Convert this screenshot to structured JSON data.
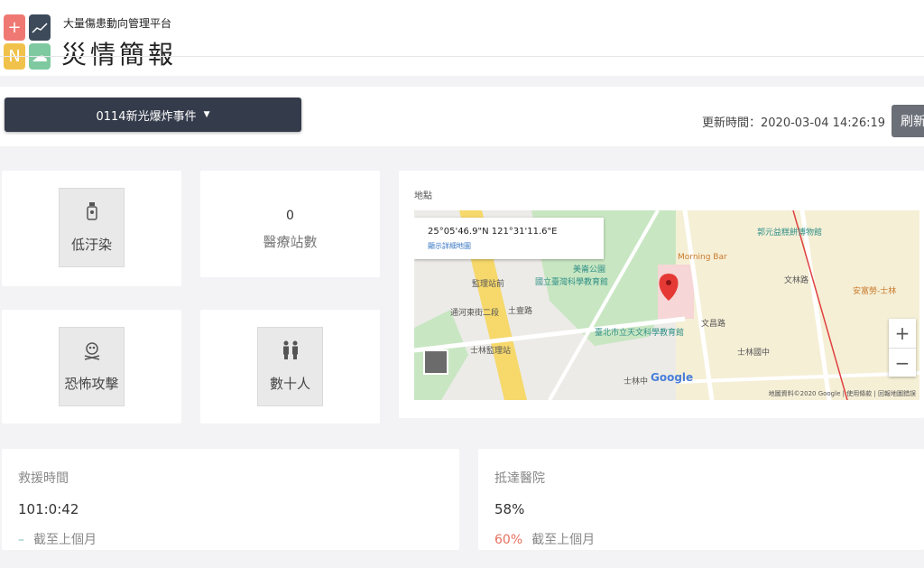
{
  "header": {
    "subtitle": "大量傷患動向管理平台",
    "title": "災情簡報",
    "logo_icons": [
      "plus-icon",
      "trend-icon",
      "n-letter-icon",
      "cloud-icon"
    ]
  },
  "toolbar": {
    "event_label": "0114新光爆炸事件",
    "update_time": "更新時間：2020-03-04 14:26:19",
    "refresh_label": "刷新"
  },
  "tiles": {
    "pollution": "低汙染",
    "terror": "恐怖攻擊",
    "people": "數十人"
  },
  "stats": {
    "medical_stations": {
      "value": "0",
      "label": "醫療站數"
    }
  },
  "map": {
    "title": "地點",
    "coords": "25°05'46.9\"N 121°31'11.6\"E",
    "detail_link": "顯示詳細地圖",
    "labels": {
      "a": "國立臺灣科學教育館",
      "b": "美崙公園",
      "c": "臺北市立天文科學教育館",
      "d": "士林監理站",
      "e": "監理站前",
      "f": "士林國中",
      "g": "Morning Bar",
      "h": "郭元益糕餅博物館",
      "i": "士林中",
      "j": "文昌路",
      "k": "文林路",
      "l": "土壹路",
      "m": "通河東街二段",
      "n": "安富勞-士林"
    },
    "google": "Google",
    "attribution": "地圖資料©2020 Google | 使用條款 | 回報地圖錯誤"
  },
  "rescue": {
    "title": "救援時間",
    "value": "101:0:42",
    "note_dash": "–",
    "note": "截至上個月"
  },
  "hospital": {
    "title": "抵達醫院",
    "value": "58%",
    "note_pct": "60%",
    "note": "截至上個月"
  },
  "colors": {
    "dark_button": "#343b4a",
    "accent_red": "#e5715f",
    "accent_teal": "#7cc0b6"
  }
}
